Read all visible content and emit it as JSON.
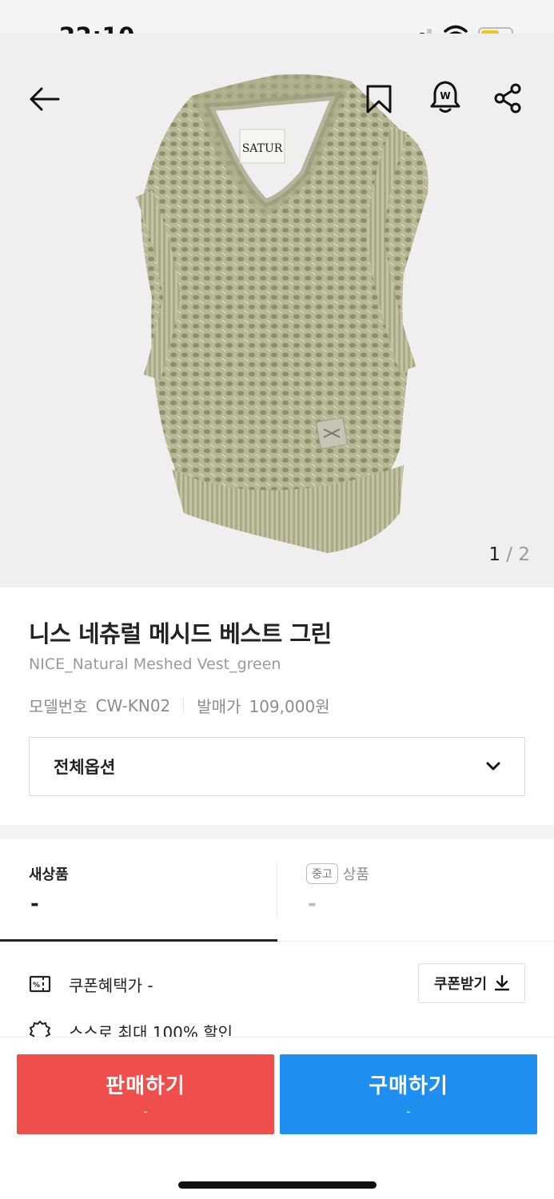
{
  "status_bar": {
    "time": "22:10",
    "battery_level": 0.55,
    "battery_color": "#f5c519"
  },
  "hero": {
    "icons": [
      "back-arrow-icon",
      "bookmark-icon",
      "price-alert-bell-icon",
      "share-icon"
    ],
    "image_alt": "green knit mesh vest",
    "pager": {
      "current": "1",
      "separator": "/",
      "total": "2"
    }
  },
  "product": {
    "name_ko": "니스 네츄럴 메시드 베스트 그린",
    "name_en": "NICE_Natural Meshed Vest_green",
    "model_label": "모델번호",
    "model_value": "CW-KN02",
    "release_label": "발매가",
    "release_value": "109,000원"
  },
  "option_select": {
    "label": "전체옵션",
    "icon": "chevron-down-icon"
  },
  "price_tabs": {
    "new": {
      "label": "새상품",
      "price": "-"
    },
    "used": {
      "badge": "중고",
      "label": "상품",
      "price": "-"
    }
  },
  "benefits": {
    "coupon_text": "쿠폰혜택가 -",
    "coupon_button": "쿠폰받기",
    "cut_text": "스스로 최대 100% 할인"
  },
  "actions": {
    "sell": {
      "label": "판매하기",
      "price": "-"
    },
    "buy": {
      "label": "구매하기",
      "price": "-"
    }
  },
  "colors": {
    "sell": "#ef4f4c",
    "buy": "#1f8ef1"
  }
}
